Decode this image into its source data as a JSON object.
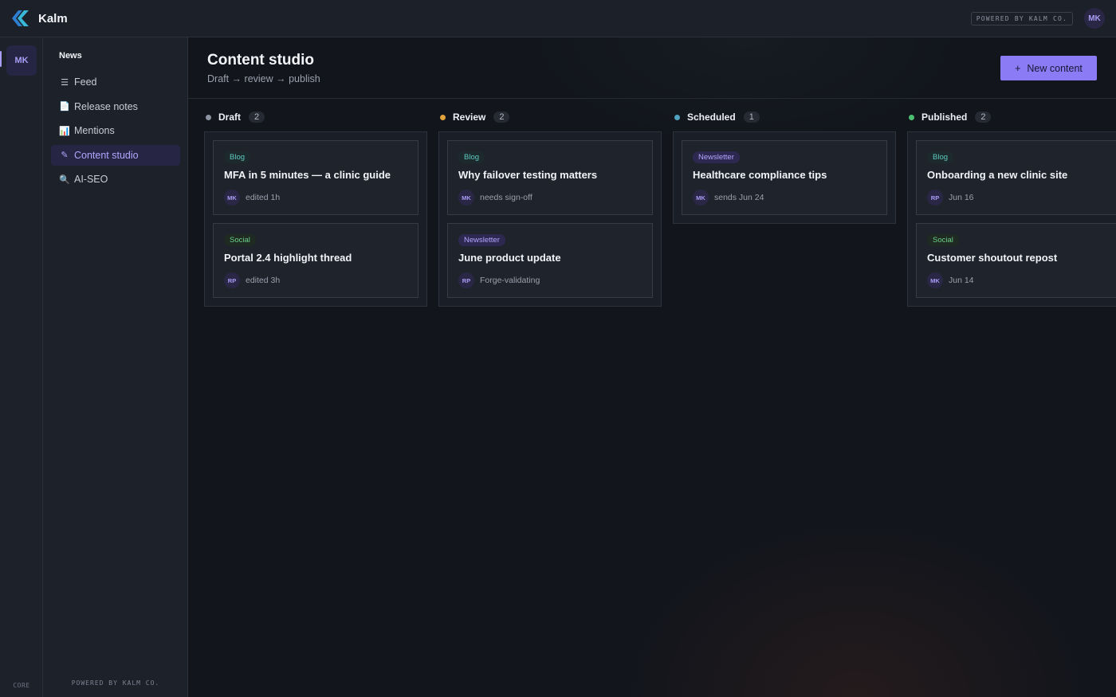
{
  "app": {
    "name": "Kalm",
    "powered": "POWERED BY KALM CO.",
    "user_initials": "MK"
  },
  "rail": {
    "avatar": "MK",
    "footer": "CORE"
  },
  "sidebar": {
    "heading": "News",
    "items": [
      {
        "icon": "☰",
        "label": "Feed"
      },
      {
        "icon": "📄",
        "label": "Release notes"
      },
      {
        "icon": "📊",
        "label": "Mentions"
      },
      {
        "icon": "✎",
        "label": "Content studio"
      },
      {
        "icon": "🔍",
        "label": "AI-SEO"
      }
    ],
    "footer": "POWERED BY KALM CO."
  },
  "page": {
    "title": "Content studio",
    "subtitle": "Draft → review → publish",
    "new_button": "New content",
    "new_button_icon": "+"
  },
  "colors": {
    "accent": "#8b7cf6",
    "draft": "#8d93a1",
    "review": "#e2a23c",
    "scheduled": "#4fa3c0",
    "published": "#4cbf72"
  },
  "columns": [
    {
      "name": "Draft",
      "count": "2",
      "cards": [
        {
          "tag": "Blog",
          "title": "MFA in 5 minutes — a clinic guide",
          "avatar": "MK",
          "meta": "edited 1h"
        },
        {
          "tag": "Social",
          "title": "Portal 2.4 highlight thread",
          "avatar": "RP",
          "meta": "edited 3h"
        }
      ]
    },
    {
      "name": "Review",
      "count": "2",
      "cards": [
        {
          "tag": "Blog",
          "title": "Why failover testing matters",
          "avatar": "MK",
          "meta": "needs sign-off"
        },
        {
          "tag": "Newsletter",
          "title": "June product update",
          "avatar": "RP",
          "meta": "Forge-validating"
        }
      ]
    },
    {
      "name": "Scheduled",
      "count": "1",
      "cards": [
        {
          "tag": "Newsletter",
          "title": "Healthcare compliance tips",
          "avatar": "MK",
          "meta": "sends Jun 24"
        }
      ]
    },
    {
      "name": "Published",
      "count": "2",
      "cards": [
        {
          "tag": "Blog",
          "title": "Onboarding a new clinic site",
          "avatar": "RP",
          "meta": "Jun 16"
        },
        {
          "tag": "Social",
          "title": "Customer shoutout repost",
          "avatar": "MK",
          "meta": "Jun 14"
        }
      ]
    }
  ]
}
